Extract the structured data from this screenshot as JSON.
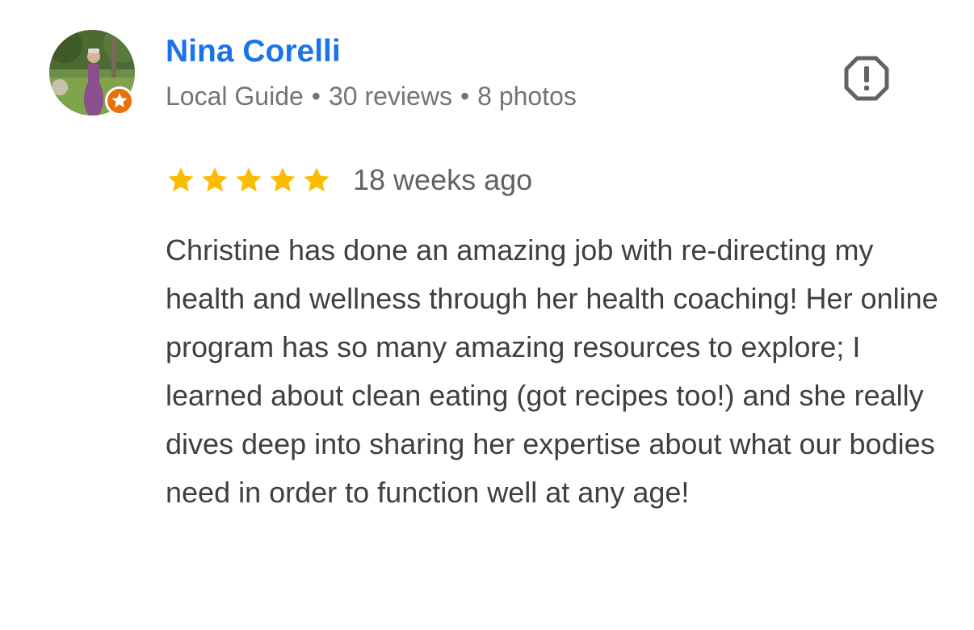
{
  "review": {
    "reviewer": {
      "name": "Nina Corelli",
      "badge_icon": "star-icon",
      "badge_color": "#e8710a",
      "meta": {
        "level": "Local Guide",
        "reviews": "30 reviews",
        "photos": "8 photos",
        "separator": "•"
      }
    },
    "flag_icon": "report-icon",
    "rating": {
      "stars": 5,
      "max": 5,
      "color": "#fbbc04"
    },
    "date": "18 weeks ago",
    "text": "Christine has done an amazing job with re-directing my health and wellness through her health coaching! Her online program has so many amazing resources to explore; I learned about clean eating (got recipes too!) and she really dives deep into sharing her expertise about what our bodies need in order to function well at any age!"
  },
  "colors": {
    "name_link": "#1a73e8",
    "meta_text": "#70757a",
    "body_text": "#3c4043",
    "icon_gray": "#5f6368"
  }
}
